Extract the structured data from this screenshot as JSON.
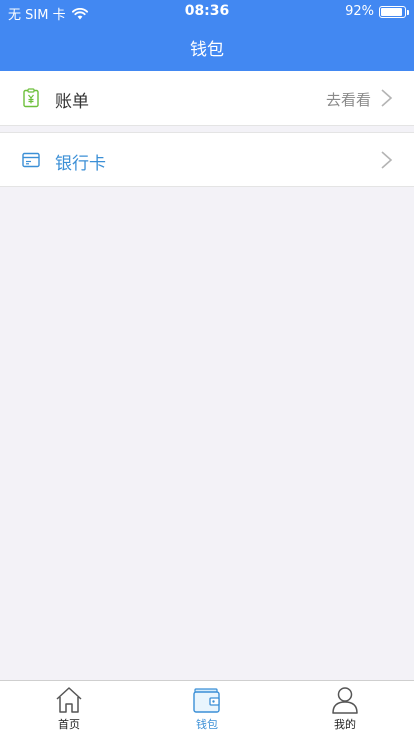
{
  "status_bar": {
    "carrier": "无 SIM 卡",
    "time": "08:36",
    "battery": "92%",
    "battery_level": 0.92,
    "wifi_icon": "wifi-icon"
  },
  "nav": {
    "title": "钱包"
  },
  "cells": {
    "bill": {
      "label": "账单",
      "detail": "去看看",
      "icon": "bill-icon"
    },
    "bank_card": {
      "label": "银行卡",
      "icon": "bank-card-icon"
    }
  },
  "tabbar": {
    "home": {
      "label": "首页",
      "icon": "home-icon"
    },
    "wallet": {
      "label": "钱包",
      "icon": "wallet-icon",
      "selected": true
    },
    "mine": {
      "label": "我的",
      "icon": "person-icon"
    }
  },
  "colors": {
    "header": "#4288f2",
    "accent": "#3b8fd6",
    "bill_icon": "#6cbf3a",
    "background": "#f3f2f7"
  }
}
